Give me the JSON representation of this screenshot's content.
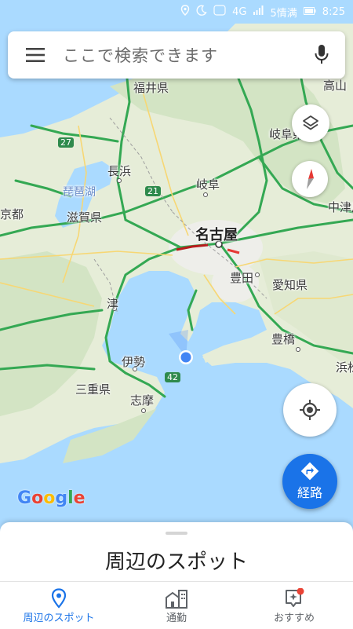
{
  "status_bar": {
    "network": "4G",
    "signal_text": "5情满",
    "time": "8:25"
  },
  "search": {
    "placeholder": "ここで検索できます"
  },
  "map": {
    "labels": {
      "fukui": "福井県",
      "takayama": "高山",
      "gifu_pref": "岐阜県",
      "nagahama": "長浜",
      "biwako": "琵琶湖",
      "gifu": "岐阜",
      "shiga": "滋賀県",
      "kyoto": "京都",
      "nakatsugawa": "中津川",
      "nagoya": "名古屋",
      "toyota": "豊田",
      "aichi": "愛知県",
      "tsu": "津",
      "toyohashi": "豊橋",
      "ise": "伊勢",
      "hamamatsu": "浜松",
      "mie": "三重県",
      "shima": "志摩"
    },
    "route_shields": {
      "r27": "27",
      "r21": "21",
      "r42": "42"
    },
    "google_logo": [
      "G",
      "o",
      "o",
      "g",
      "l",
      "e"
    ]
  },
  "route_button": {
    "label": "経路"
  },
  "sheet": {
    "title": "周辺のスポット"
  },
  "bottom_nav": {
    "tabs": [
      {
        "label": "周辺のスポット",
        "active": true
      },
      {
        "label": "通勤",
        "active": false
      },
      {
        "label": "おすすめ",
        "active": false
      }
    ]
  },
  "colors": {
    "accent": "#1a73e8",
    "water": "#aadaff",
    "land": "#e8eedc",
    "highway": "#34a853"
  }
}
